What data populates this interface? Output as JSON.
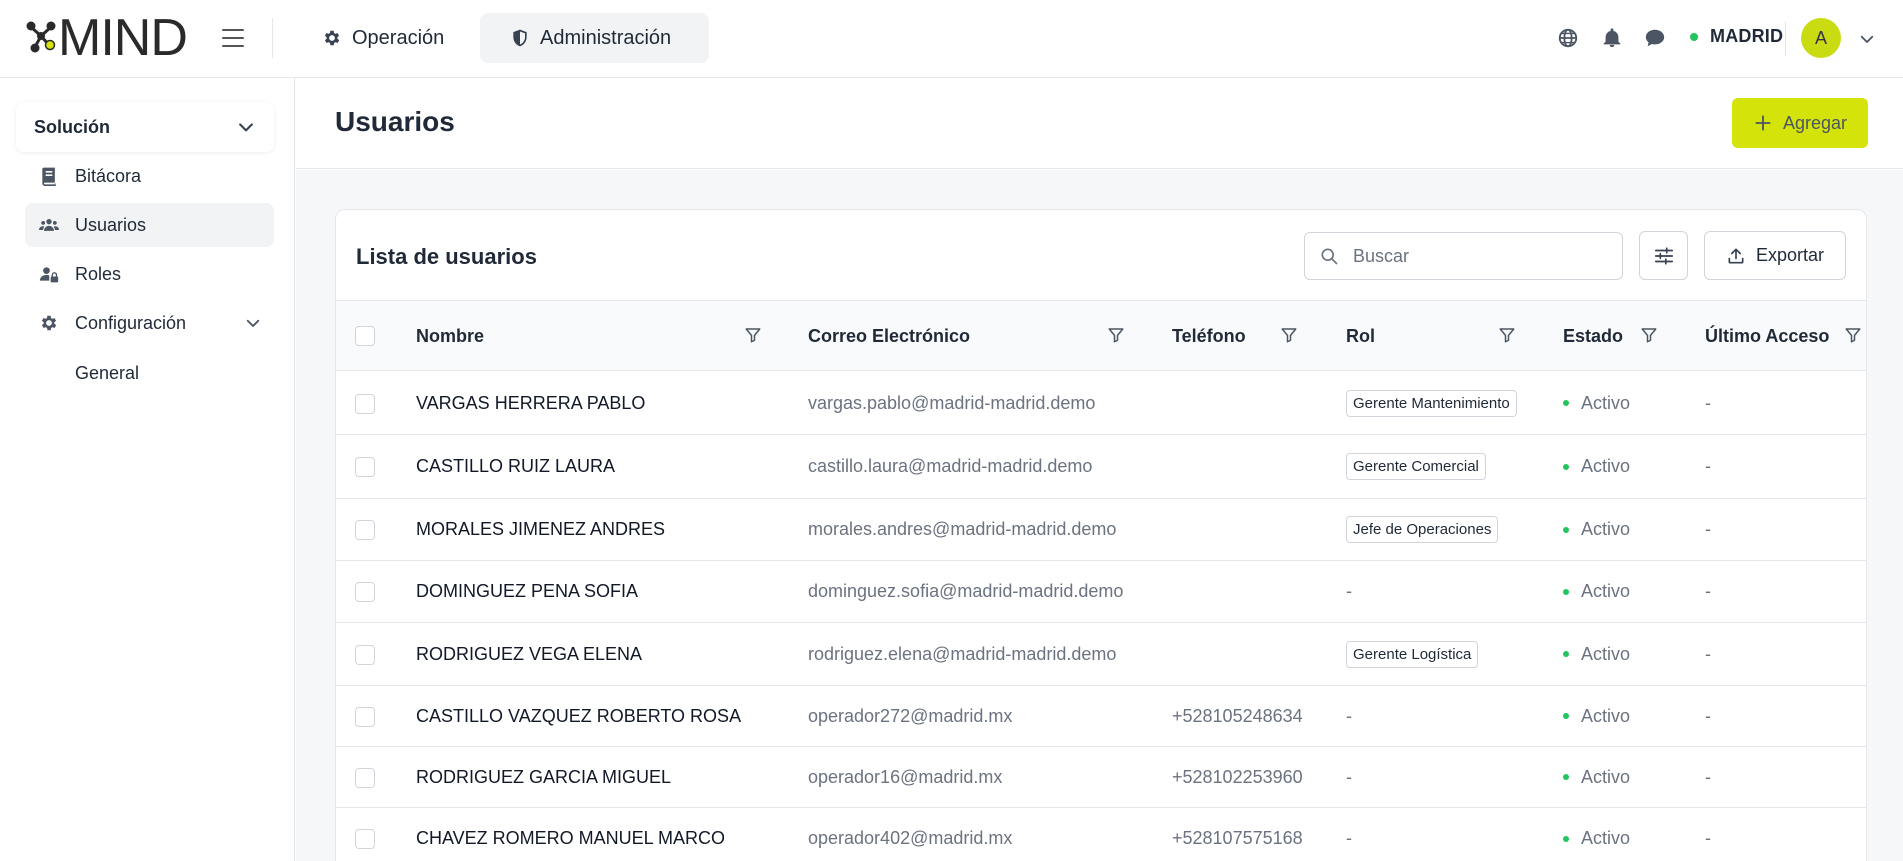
{
  "app": {
    "logo_text": "MIND"
  },
  "topnav": {
    "tabs": [
      {
        "label": "Operación",
        "icon": "gear-icon"
      },
      {
        "label": "Administración",
        "icon": "shield-icon",
        "active": true
      }
    ],
    "location": "MADRID",
    "location_status_color": "#22c55e",
    "avatar_initial": "A",
    "avatar_color": "#c9dc12"
  },
  "sidebar": {
    "section": "Solución",
    "items": [
      {
        "label": "Bitácora",
        "icon": "book-icon"
      },
      {
        "label": "Usuarios",
        "icon": "users-icon",
        "active": true
      },
      {
        "label": "Roles",
        "icon": "user-lock-icon"
      },
      {
        "label": "Configuración",
        "icon": "gear-icon",
        "expanded": true
      }
    ],
    "subitems": [
      {
        "label": "General"
      }
    ]
  },
  "page": {
    "title": "Usuarios",
    "add_button": "Agregar",
    "accent_color": "#d4e30a"
  },
  "card": {
    "title": "Lista de usuarios",
    "search_placeholder": "Buscar",
    "export_label": "Exportar"
  },
  "table": {
    "columns": [
      "Nombre",
      "Correo Electrónico",
      "Teléfono",
      "Rol",
      "Estado",
      "Último Acceso"
    ],
    "rows": [
      {
        "name": "VARGAS HERRERA PABLO",
        "email": "vargas.pablo@madrid-madrid.demo",
        "phone": "",
        "role": "Gerente Mantenimiento",
        "status": "Activo",
        "last": "-"
      },
      {
        "name": "CASTILLO RUIZ LAURA",
        "email": "castillo.laura@madrid-madrid.demo",
        "phone": "",
        "role": "Gerente Comercial",
        "status": "Activo",
        "last": "-"
      },
      {
        "name": "MORALES JIMENEZ ANDRES",
        "email": "morales.andres@madrid-madrid.demo",
        "phone": "",
        "role": "Jefe de Operaciones",
        "status": "Activo",
        "last": "-"
      },
      {
        "name": "DOMINGUEZ PENA SOFIA",
        "email": "dominguez.sofia@madrid-madrid.demo",
        "phone": "",
        "role": "-",
        "status": "Activo",
        "last": "-"
      },
      {
        "name": "RODRIGUEZ VEGA ELENA",
        "email": "rodriguez.elena@madrid-madrid.demo",
        "phone": "",
        "role": "Gerente Logística",
        "status": "Activo",
        "last": "-"
      },
      {
        "name": "CASTILLO VAZQUEZ ROBERTO ROSA",
        "email": "operador272@madrid.mx",
        "phone": "+528105248634",
        "role": "-",
        "status": "Activo",
        "last": "-"
      },
      {
        "name": "RODRIGUEZ GARCIA MIGUEL",
        "email": "operador16@madrid.mx",
        "phone": "+528102253960",
        "role": "-",
        "status": "Activo",
        "last": "-"
      },
      {
        "name": "CHAVEZ ROMERO MANUEL MARCO",
        "email": "operador402@madrid.mx",
        "phone": "+528107575168",
        "role": "-",
        "status": "Activo",
        "last": "-"
      }
    ]
  }
}
